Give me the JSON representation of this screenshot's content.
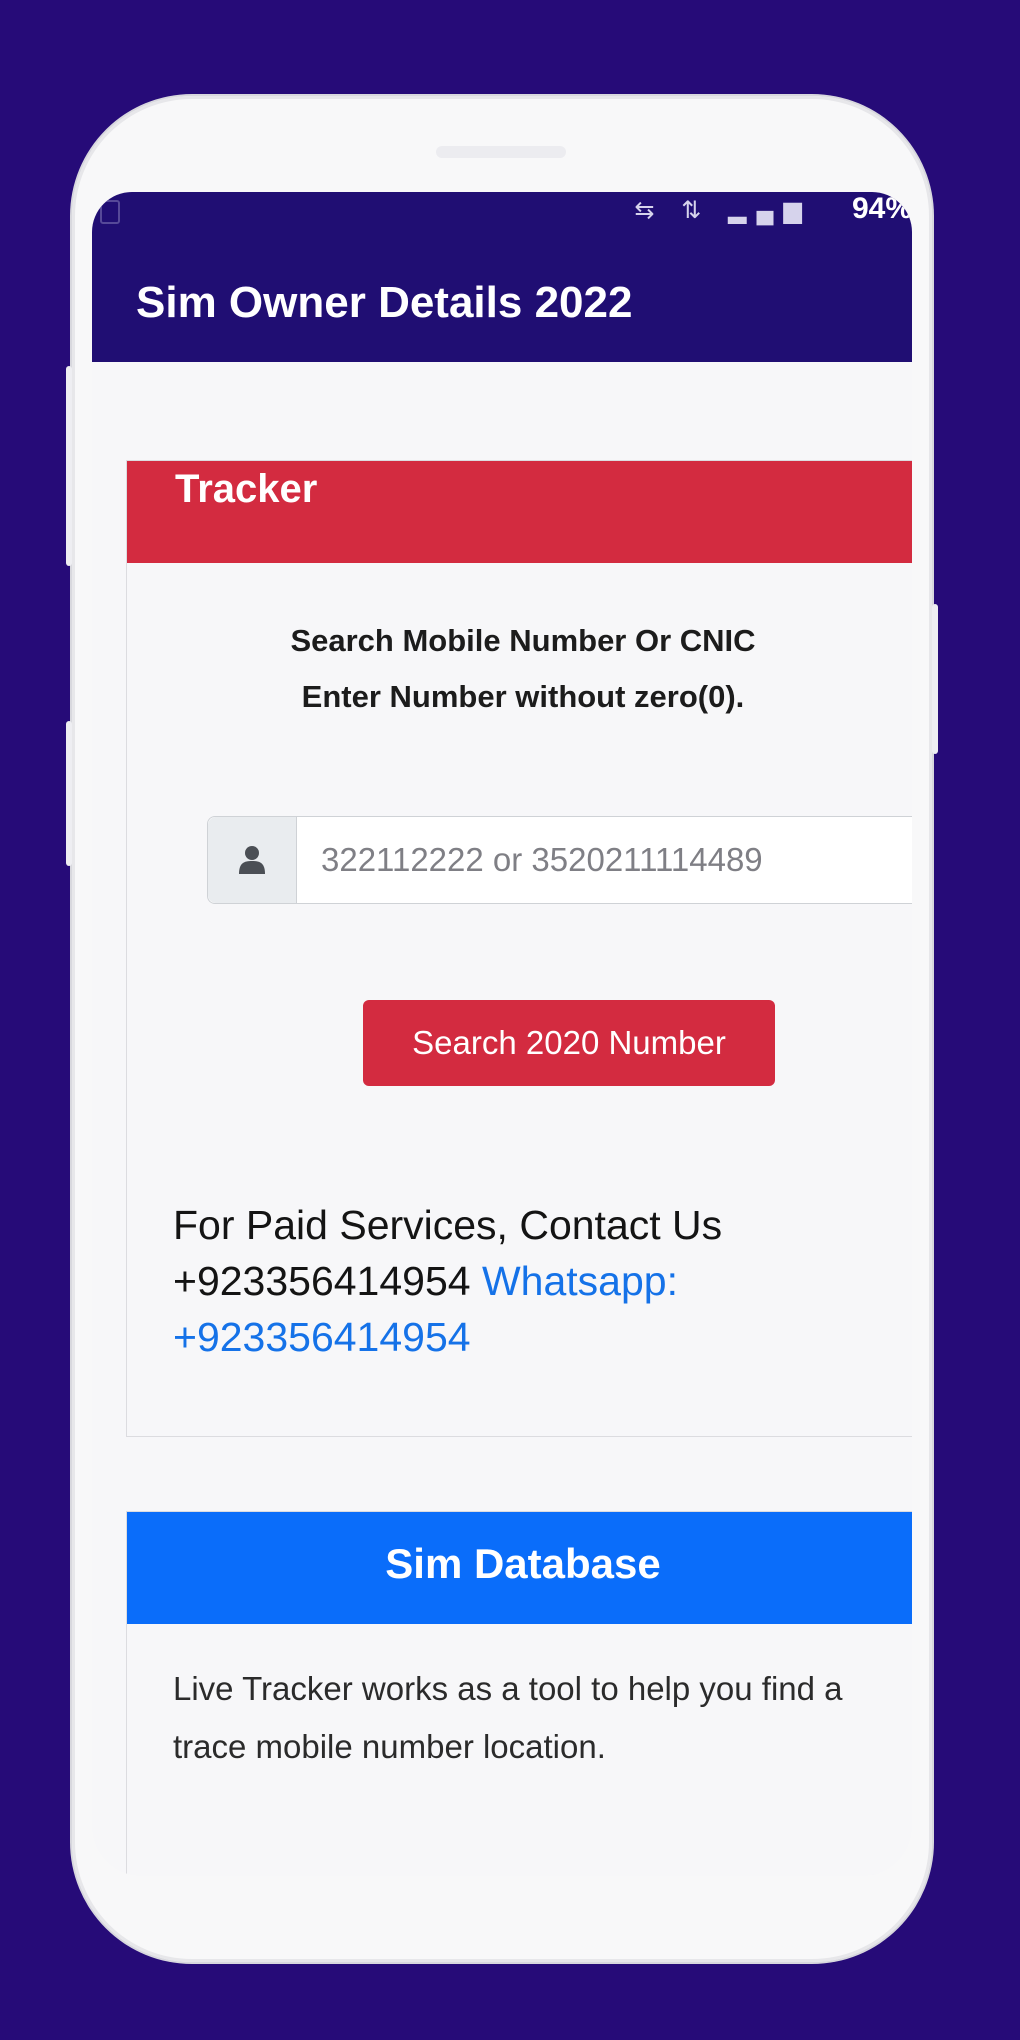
{
  "statusbar": {
    "battery": "94%"
  },
  "appbar": {
    "title": "Sim Owner Details 2022"
  },
  "tracker_card": {
    "header": "Tracker",
    "instruction_line1": "Search Mobile Number Or CNIC",
    "instruction_line2": "Enter Number without zero(0).",
    "input": {
      "placeholder": "322112222 or 3520211114489",
      "value": ""
    },
    "search_button": "Search 2020 Number",
    "paid_line1": "For Paid Services, Contact Us",
    "paid_phone": "+923356414954",
    "paid_whatsapp_label": "Whatsapp:",
    "paid_whatsapp_number": "+923356414954"
  },
  "database_card": {
    "header": "Sim Database",
    "body_line1": "Live Tracker works as a tool to help you find a",
    "body_line2": "trace mobile number location."
  },
  "colors": {
    "background": "#260b78",
    "appbar": "#200e73",
    "tracker_header": "#d32b40",
    "database_header": "#0a6dfa",
    "link": "#1572e8"
  },
  "icons": {
    "input_addon": "user-icon"
  }
}
